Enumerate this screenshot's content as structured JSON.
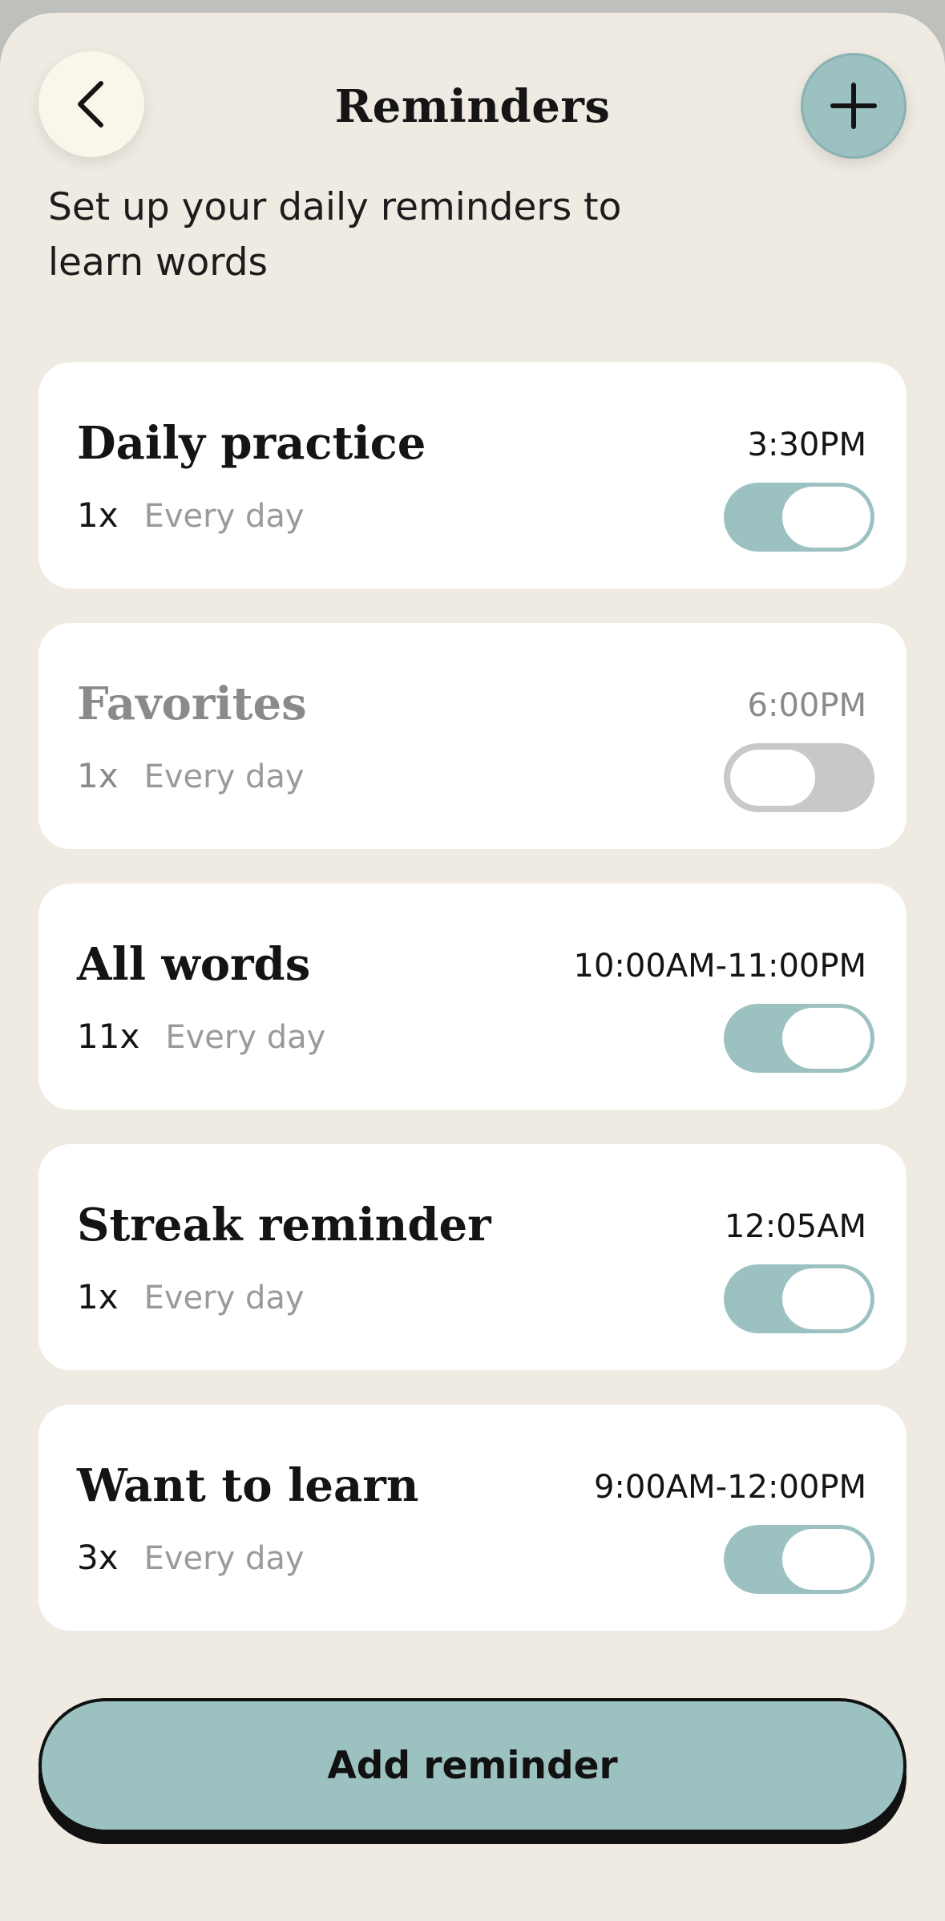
{
  "header": {
    "title": "Reminders",
    "subtitle": "Set up your daily reminders to learn words"
  },
  "icons": {
    "back": "chevron-left-icon",
    "add": "plus-icon"
  },
  "reminders": [
    {
      "name": "Daily practice",
      "time": "3:30PM",
      "count": "1x",
      "frequency": "Every day",
      "enabled": true
    },
    {
      "name": "Favorites",
      "time": "6:00PM",
      "count": "1x",
      "frequency": "Every day",
      "enabled": false
    },
    {
      "name": "All words",
      "time": "10:00AM-11:00PM",
      "count": "11x",
      "frequency": "Every day",
      "enabled": true
    },
    {
      "name": "Streak reminder",
      "time": "12:05AM",
      "count": "1x",
      "frequency": "Every day",
      "enabled": true
    },
    {
      "name": "Want to learn",
      "time": "9:00AM-12:00PM",
      "count": "3x",
      "frequency": "Every day",
      "enabled": true
    }
  ],
  "footer": {
    "add_label": "Add reminder"
  },
  "colors": {
    "background": "#efebe3",
    "accent": "#9cc1c1",
    "card": "#ffffff",
    "toggle_off": "#c8c8c9",
    "text_primary": "#141414",
    "text_muted": "#9a9a9a"
  }
}
